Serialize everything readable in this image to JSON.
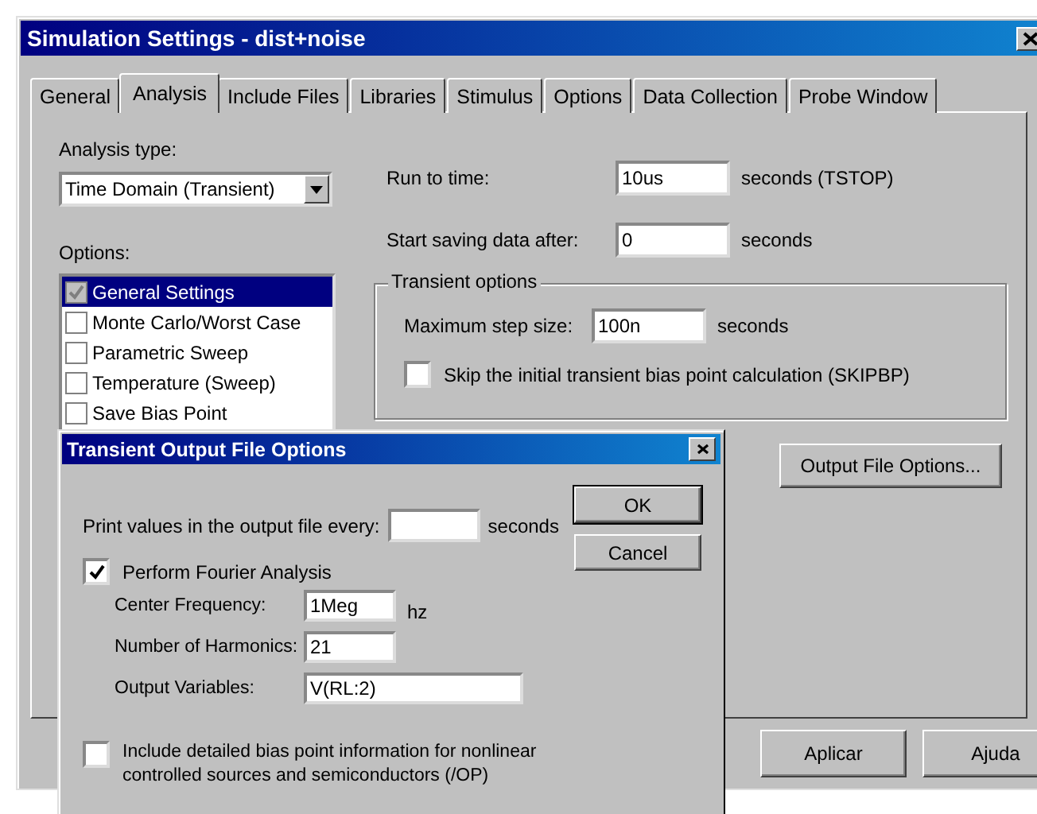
{
  "window": {
    "title": "Simulation Settings - dist+noise"
  },
  "tabs": [
    {
      "label": "General",
      "selected": false
    },
    {
      "label": "Analysis",
      "selected": true
    },
    {
      "label": "Include Files",
      "selected": false
    },
    {
      "label": "Libraries",
      "selected": false
    },
    {
      "label": "Stimulus",
      "selected": false
    },
    {
      "label": "Options",
      "selected": false
    },
    {
      "label": "Data Collection",
      "selected": false
    },
    {
      "label": "Probe Window",
      "selected": false
    }
  ],
  "analysis_type": {
    "label": "Analysis type:",
    "value": "Time Domain (Transient)"
  },
  "options": {
    "label": "Options:",
    "items": [
      {
        "label": "General Settings",
        "checked": true,
        "disabled": true,
        "selected": true
      },
      {
        "label": "Monte Carlo/Worst Case",
        "checked": false,
        "disabled": false,
        "selected": false
      },
      {
        "label": "Parametric Sweep",
        "checked": false,
        "disabled": false,
        "selected": false
      },
      {
        "label": "Temperature (Sweep)",
        "checked": false,
        "disabled": false,
        "selected": false
      },
      {
        "label": "Save Bias Point",
        "checked": false,
        "disabled": false,
        "selected": false
      }
    ]
  },
  "fields": [
    {
      "label": "Run to time:",
      "value": "10us",
      "unit": "seconds  (TSTOP)"
    },
    {
      "label": "Start saving data after:",
      "value": "0",
      "unit": "seconds"
    }
  ],
  "transient_options": {
    "title": "Transient options",
    "max_step": {
      "label": "Maximum step size:",
      "value": "100n",
      "unit": "seconds"
    },
    "skip_bias": {
      "label": "Skip the initial transient bias point calculation  (SKIPBP)",
      "checked": false
    }
  },
  "output_file_button": "Output File Options...",
  "buttons": [
    "Aplicar",
    "Ajuda"
  ],
  "dialog": {
    "title": "Transient Output File Options",
    "print_every": {
      "label": "Print values in the output file every:",
      "unit": "seconds"
    },
    "buttons": [
      "OK",
      "Cancel"
    ],
    "fourier": {
      "label": "Perform Fourier Analysis",
      "checked": true,
      "fields": [
        {
          "label": "Center Frequency:",
          "value": "1Meg",
          "unit": "hz"
        },
        {
          "label": "Number of Harmonics:",
          "value": "21"
        },
        {
          "label": "Output Variables:",
          "value": "V(RL:2)"
        }
      ]
    },
    "include_bias": {
      "label": "Include detailed bias point information for nonlinear\ncontrolled sources and semiconductors (/OP)",
      "checked": false
    }
  }
}
